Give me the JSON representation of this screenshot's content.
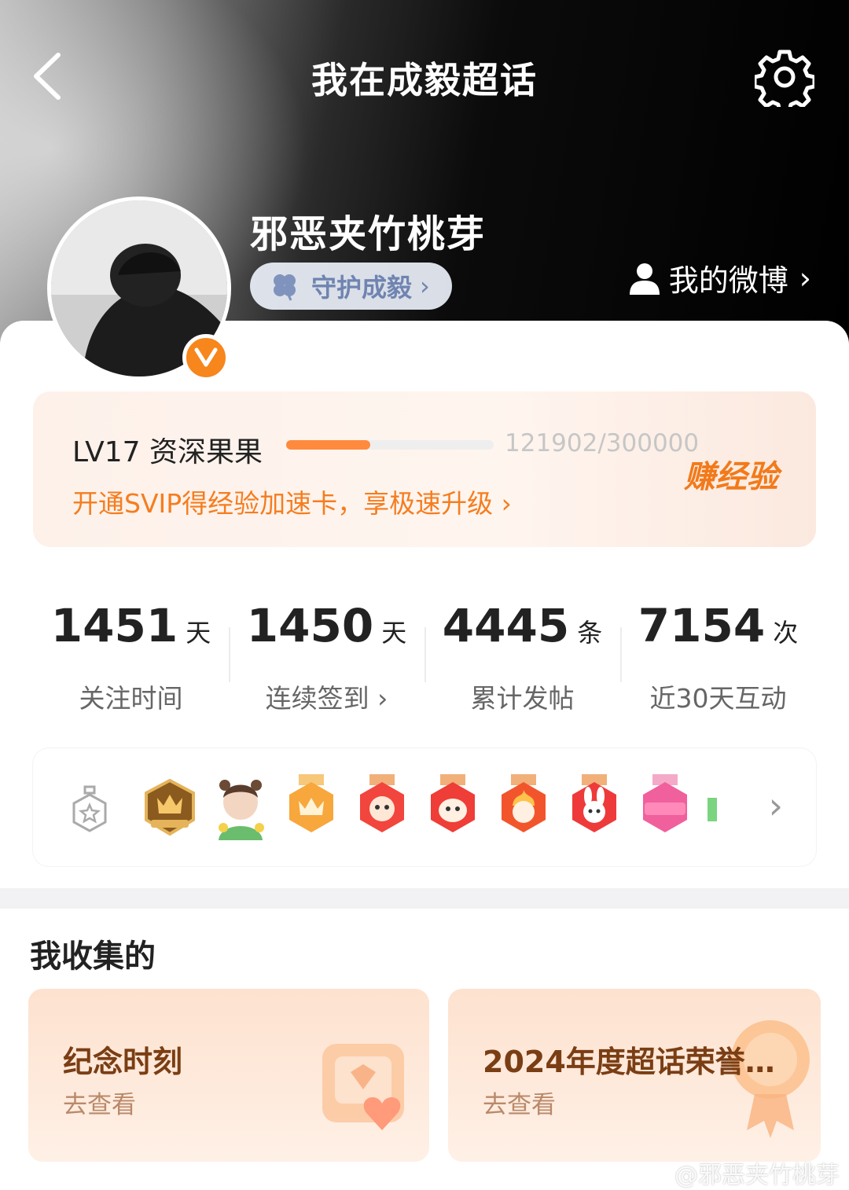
{
  "header": {
    "title": "我在成毅超话",
    "back_icon": "chevron-left-icon",
    "settings_icon": "gear-icon"
  },
  "profile": {
    "username": "邪恶夹竹桃芽",
    "guard_label": "守护成毅",
    "guard_chevron": "›",
    "my_weibo_label": "我的微博",
    "my_weibo_chevron": "›",
    "verified_icon": "v-badge-icon"
  },
  "level": {
    "title": "LV17 资深果果",
    "progress_text": "121902/300000",
    "progress_fraction": 0.406,
    "earn_label": "赚经验",
    "svip_link": "开通SVIP得经验加速卡，享极速升级 ›",
    "accent": "#ff8a3d"
  },
  "stats": [
    {
      "num": "1451",
      "unit": "天",
      "label": "关注时间"
    },
    {
      "num": "1450",
      "unit": "天",
      "label": "连续签到 ›"
    },
    {
      "num": "4445",
      "unit": "条",
      "label": "累计发帖"
    },
    {
      "num": "7154",
      "unit": "次",
      "label": "近30天互动"
    }
  ],
  "badges": {
    "items": [
      "star-medal-icon",
      "super-crown-badge",
      "avatar-badge",
      "crown-badge",
      "dragon-badge",
      "dragon-badge-2",
      "flame-dragon-badge",
      "rabbit-badge",
      "lv17-badge"
    ],
    "chevron": "›"
  },
  "collection": {
    "title": "我收集的",
    "cards": [
      {
        "title": "纪念时刻",
        "sub": "去查看"
      },
      {
        "title": "2024年度超话荣誉…",
        "sub": "去查看"
      }
    ]
  },
  "watermark": "@邪恶夹竹桃芽"
}
